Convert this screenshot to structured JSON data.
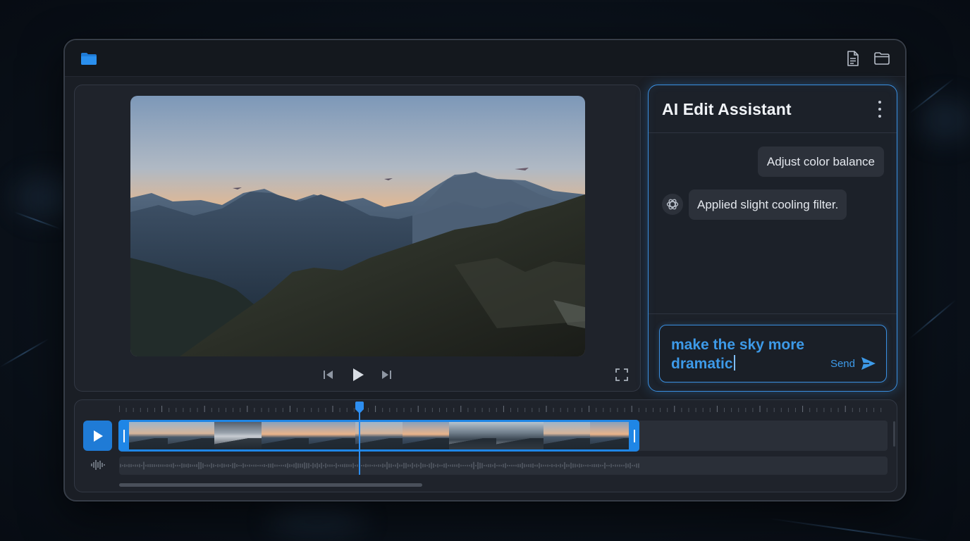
{
  "window": {
    "toolbar_icons": [
      "folder-icon",
      "document-icon",
      "folder-outline-icon"
    ],
    "accent_color": "#1f86e6"
  },
  "preview": {
    "image": "mountain-sunset-landscape",
    "controls": [
      "skip-back-icon",
      "play-icon",
      "skip-forward-icon",
      "fullscreen-icon"
    ]
  },
  "assistant": {
    "title": "AI Edit Assistant",
    "messages": [
      {
        "role": "user",
        "text": "Adjust color balance"
      },
      {
        "role": "assistant",
        "text": "Applied slight cooling filter."
      }
    ],
    "input": {
      "value": "make the sky more dramatic"
    },
    "send_label": "Send"
  },
  "timeline": {
    "frames": [
      "mountain",
      "mountain",
      "cloudy-sky",
      "sunset",
      "sunset",
      "mountain",
      "sunset",
      "road",
      "road",
      "mountain",
      "sunset"
    ],
    "playhead_progress": 0.31
  }
}
